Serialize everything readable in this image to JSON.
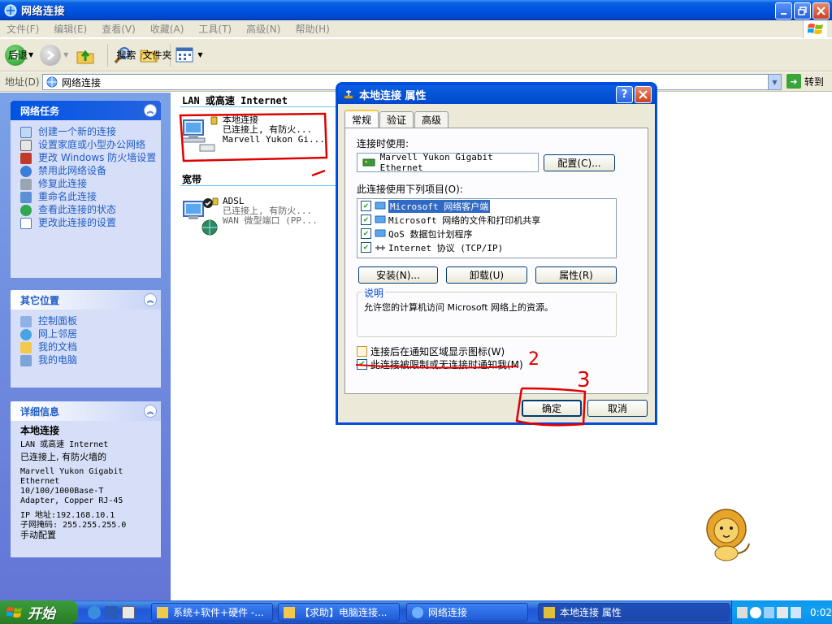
{
  "window": {
    "title": "网络连接",
    "controls": [
      "minimize",
      "maximize",
      "close"
    ]
  },
  "menubar": {
    "items": [
      "文件(F)",
      "编辑(E)",
      "查看(V)",
      "收藏(A)",
      "工具(T)",
      "高级(N)",
      "帮助(H)"
    ]
  },
  "toolbar": {
    "back": "后退",
    "search": "搜索",
    "folders": "文件夹"
  },
  "address": {
    "label": "地址(D)",
    "value": "网络连接",
    "go": "转到"
  },
  "taskpane": {
    "network_tasks": {
      "title": "网络任务",
      "items": [
        "创建一个新的连接",
        "设置家庭或小型办公网络",
        "更改 Windows 防火墙设置",
        "禁用此网络设备",
        "修复此连接",
        "重命名此连接",
        "查看此连接的状态",
        "更改此连接的设置"
      ]
    },
    "other_places": {
      "title": "其它位置",
      "items": [
        "控制面板",
        "网上邻居",
        "我的文档",
        "我的电脑"
      ]
    },
    "details": {
      "title": "详细信息",
      "name": "本地连接",
      "type": "LAN 或高速 Internet",
      "status": "已连接上, 有防火墙的",
      "adapter": "Marvell Yukon Gigabit Ethernet 10/100/1000Base-T Adapter, Copper RJ-45",
      "ip": "IP 地址:192.168.10.1",
      "mask": "子网掩码: 255.255.255.0",
      "assign": "手动配置"
    }
  },
  "main": {
    "group_lan": "LAN 或高速 Internet",
    "group_broadband": "宽带",
    "lan_conn": {
      "name": "本地连接",
      "status": "已连接上, 有防火...",
      "device": "Marvell Yukon Gi..."
    },
    "adsl_conn": {
      "name": "ADSL",
      "status": "已连接上, 有防火...",
      "device": "WAN 微型端口 (PP..."
    }
  },
  "dialog": {
    "title": "本地连接 属性",
    "tabs": [
      "常规",
      "验证",
      "高级"
    ],
    "connect_using_label": "连接时使用:",
    "adapter_value": "Marvell Yukon Gigabit Ethernet",
    "configure_button": "配置(C)...",
    "items_label": "此连接使用下列项目(O):",
    "items": [
      "Microsoft 网络客户端",
      "Microsoft 网络的文件和打印机共享",
      "QoS 数据包计划程序",
      "Internet 协议 (TCP/IP)"
    ],
    "install_button": "安装(N)...",
    "uninstall_button": "卸载(U)",
    "properties_button": "属性(R)",
    "description_title": "说明",
    "description_text": "允许您的计算机访问 Microsoft 网络上的资源。",
    "show_icon_label": "连接后在通知区域显示图标(W)",
    "notify_label": "此连接被限制或无连接时通知我(M)",
    "ok_button": "确定",
    "cancel_button": "取消"
  },
  "annotations": [
    "2",
    "3"
  ],
  "taskbar": {
    "start": "开始",
    "buttons": [
      "系统+软件+硬件 -...",
      "【求助】电脑连接...",
      "网络连接",
      "本地连接 属性"
    ],
    "clock": "0:02"
  }
}
